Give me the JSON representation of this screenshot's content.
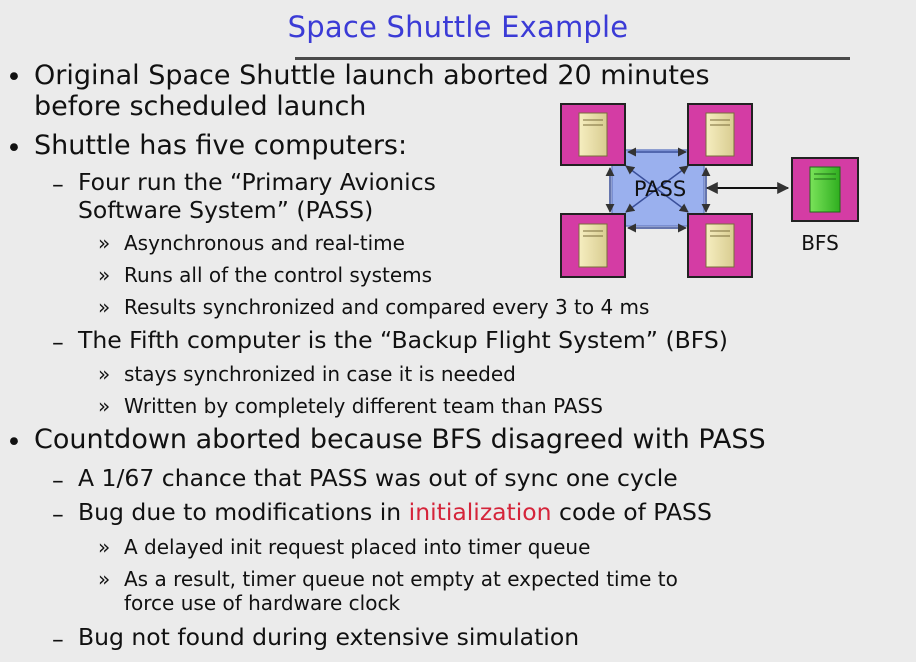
{
  "title": "Space Shuttle Example",
  "bullets": {
    "b1_line1": "Original Space Shuttle launch aborted 20 minutes",
    "b1_line2": "before scheduled launch",
    "b2": "Shuttle has five computers:",
    "b2_s1_line1": "Four run the “Primary Avionics",
    "b2_s1_line2": "Software System” (PASS)",
    "b2_s1_i1": "Asynchronous and real-time",
    "b2_s1_i2": "Runs all of the control systems",
    "b2_s1_i3": "Results synchronized and compared every 3 to 4 ms",
    "b2_s2": "The Fifth computer is the “Backup Flight System” (BFS)",
    "b2_s2_i1": "stays synchronized in case it is needed",
    "b2_s2_i2": "Written by completely different team than PASS",
    "b3": "Countdown aborted because BFS disagreed with PASS",
    "b3_s1": "A 1/67 chance that PASS was out of sync one cycle",
    "b3_s2_pre": "Bug due to modifications in ",
    "b3_s2_hl": "initialization",
    "b3_s2_post": " code of PASS",
    "b3_s2_i1": "A delayed init request placed into timer queue",
    "b3_s2_i2_line1": "As a result, timer queue not empty at expected time to",
    "b3_s2_i2_line2": "force use of hardware clock",
    "b3_s3": "Bug not found during extensive simulation"
  },
  "markers": {
    "l1": "•",
    "l2": "–",
    "l3": "»"
  },
  "diagram": {
    "pass_label": "PASS",
    "bfs_label": "BFS"
  },
  "colors": {
    "title": "#3b3bd6",
    "highlight": "#d5243a",
    "computer_frame": "#d43ca4",
    "pass_box": "#9ab0ee",
    "arrow": "#3a4f9a",
    "bfs_computer": "#4fd23a"
  }
}
